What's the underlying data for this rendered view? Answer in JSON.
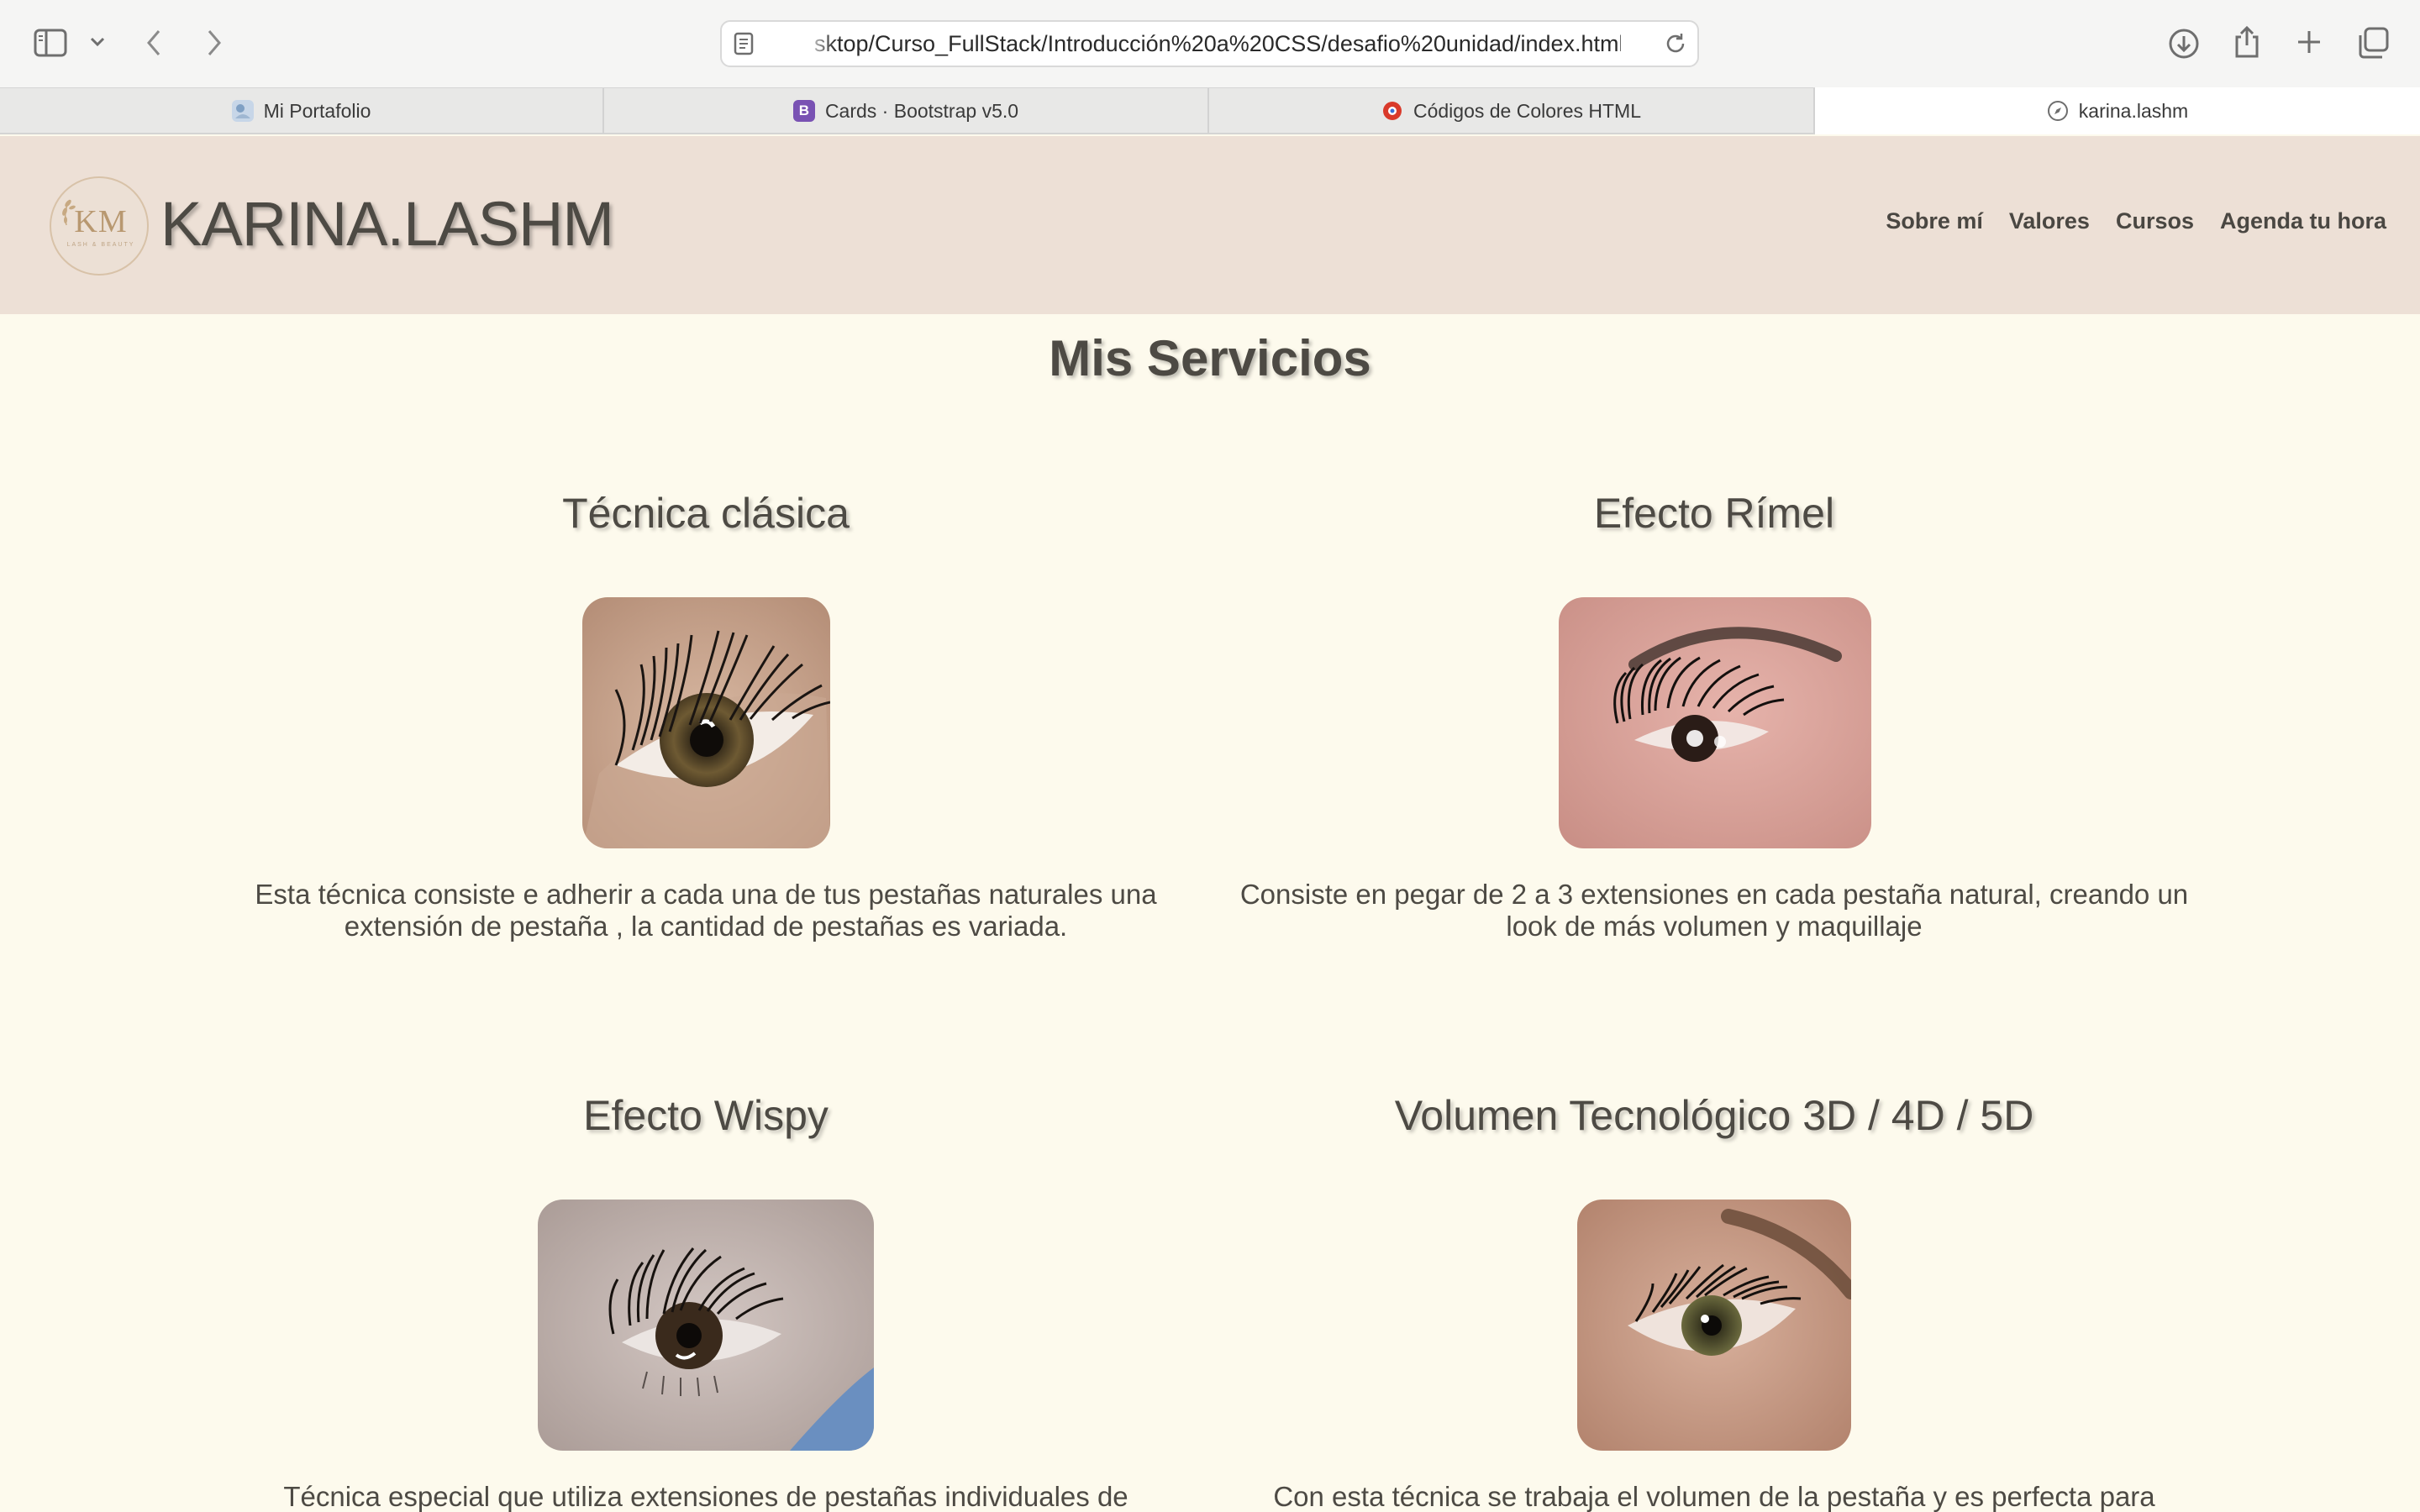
{
  "browser": {
    "url": "sktop/Curso_FullStack/Introducción%20a%20CSS/desafio%20unidad/index.html",
    "tabs": [
      {
        "label": "Mi Portafolio",
        "favicon": "portfolio-favicon",
        "active": false
      },
      {
        "label": "Cards · Bootstrap v5.0",
        "favicon": "bootstrap-favicon",
        "favicon_text": "B",
        "active": false
      },
      {
        "label": "Códigos de Colores HTML",
        "favicon": "colors-favicon",
        "active": false
      },
      {
        "label": "karina.lashm",
        "favicon": "compass-icon",
        "active": true
      }
    ]
  },
  "header": {
    "logo_monogram": "KM",
    "logo_tagline": "LASH & BEAUTY",
    "brand": "KARINA.LASHM",
    "nav": [
      "Sobre mí",
      "Valores",
      "Cursos",
      "Agenda tu hora"
    ]
  },
  "main": {
    "title": "Mis Servicios",
    "services": [
      {
        "title": "Técnica clásica",
        "image": "classic-lash-eye-photo",
        "text": "Esta técnica consiste e adherir a cada una de tus pestañas naturales una extensión de pestaña , la cantidad de pestañas es variada."
      },
      {
        "title": "Efecto Rímel",
        "image": "mascara-effect-eye-photo",
        "text": "Consiste en pegar de 2 a 3 extensiones en cada pestaña natural, creando un look de más volumen y maquillaje"
      },
      {
        "title": "Efecto Wispy",
        "image": "wispy-effect-eye-photo",
        "text": "Técnica especial que utiliza extensiones de pestañas individuales de"
      },
      {
        "title": "Volumen Tecnológico 3D / 4D / 5D",
        "image": "volume-lash-eye-photo",
        "text": "Con esta técnica se trabaja el volumen de la pestaña y es perfecta para"
      }
    ]
  },
  "colors": {
    "page_bg": "#fdfaed",
    "header_bg": "#ede0d6",
    "text": "#4d4a44",
    "logo_gold": "#b89870"
  }
}
